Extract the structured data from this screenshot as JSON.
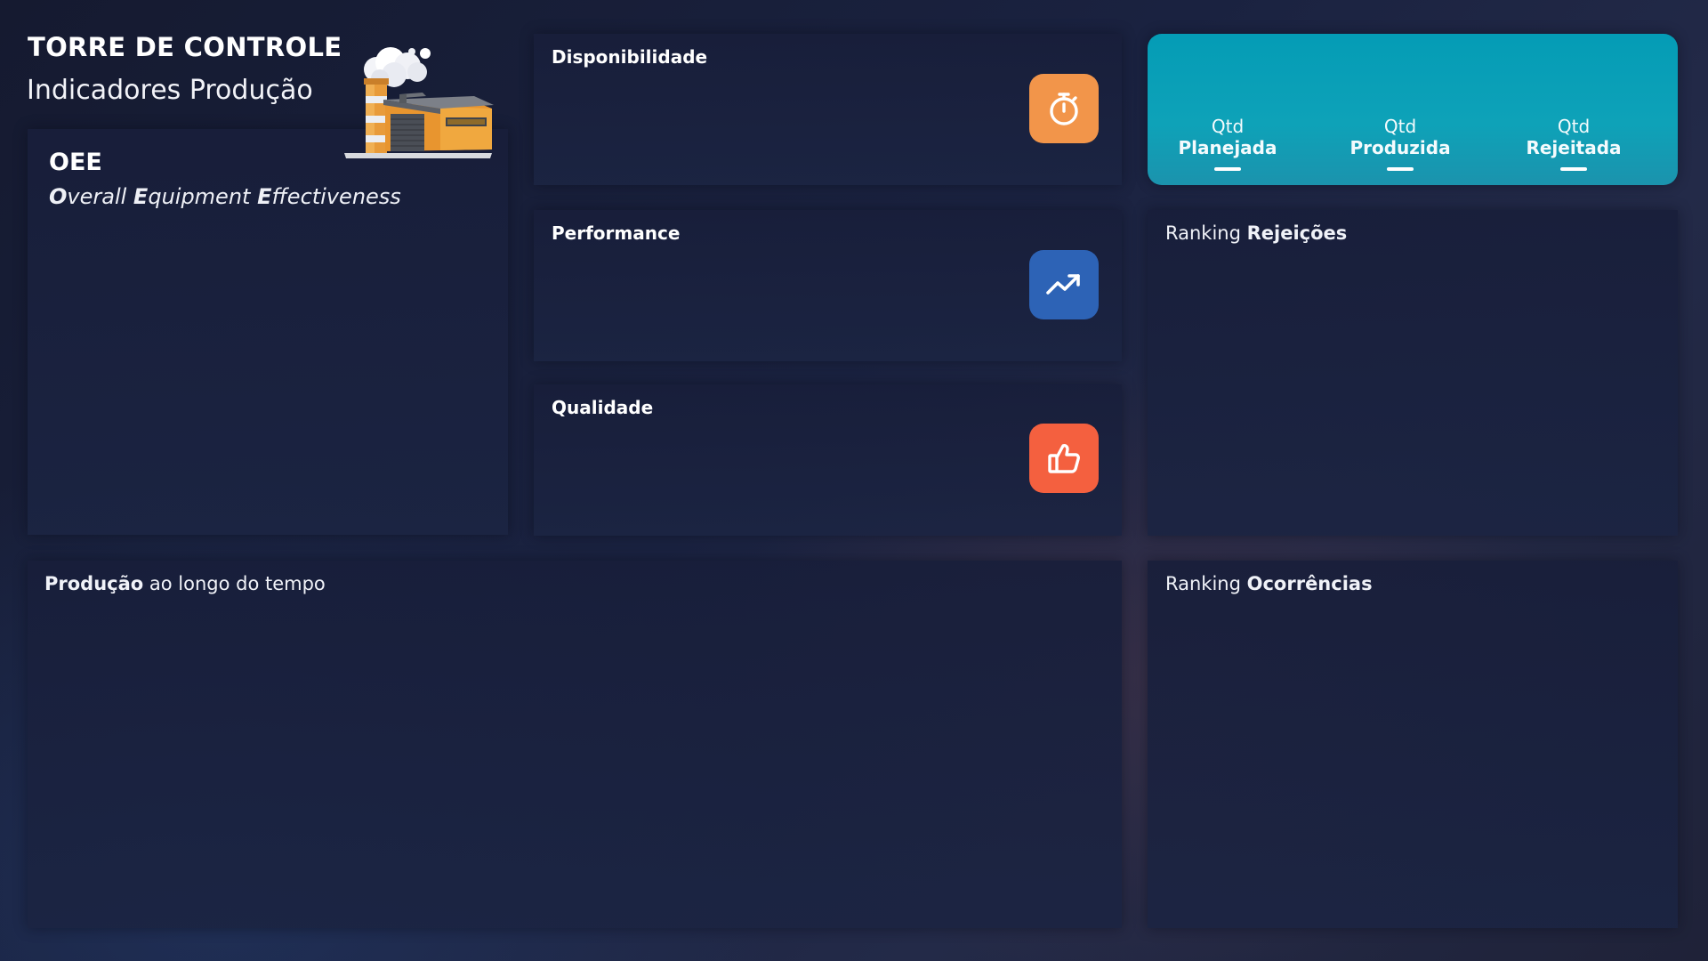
{
  "header": {
    "title": "TORRE DE CONTROLE",
    "subtitle": "Indicadores Produção",
    "illustration": "factory-illustration"
  },
  "oee": {
    "heading": "OEE",
    "parts": [
      {
        "initial": "O",
        "rest": "verall "
      },
      {
        "initial": "E",
        "rest": "quipment "
      },
      {
        "initial": "E",
        "rest": "ffectiveness"
      }
    ]
  },
  "cards": {
    "disponibilidade": {
      "title": "Disponibilidade",
      "icon": "stopwatch-icon",
      "color": "#f2954a"
    },
    "performance": {
      "title": "Performance",
      "icon": "trending-up-icon",
      "color": "#2d63b6"
    },
    "qualidade": {
      "title": "Qualidade",
      "icon": "thumbs-up-icon",
      "color": "#f4603f"
    }
  },
  "kpis": [
    {
      "prefix": "Qtd ",
      "bold": "Planejada"
    },
    {
      "prefix": "Qtd ",
      "bold": "Produzida"
    },
    {
      "prefix": "Qtd ",
      "bold": "Rejeitada"
    }
  ],
  "ranking_rejeicoes": {
    "prefix": "Ranking ",
    "bold": "Rejeições"
  },
  "producao": {
    "bold": "Produção",
    "rest": " ao longo do tempo"
  },
  "ranking_ocorrencias": {
    "prefix": "Ranking ",
    "bold": "Ocorrências"
  },
  "colors": {
    "kpi_panel": "#049cb6",
    "panel": "#1a2140",
    "background": "#181d35"
  }
}
